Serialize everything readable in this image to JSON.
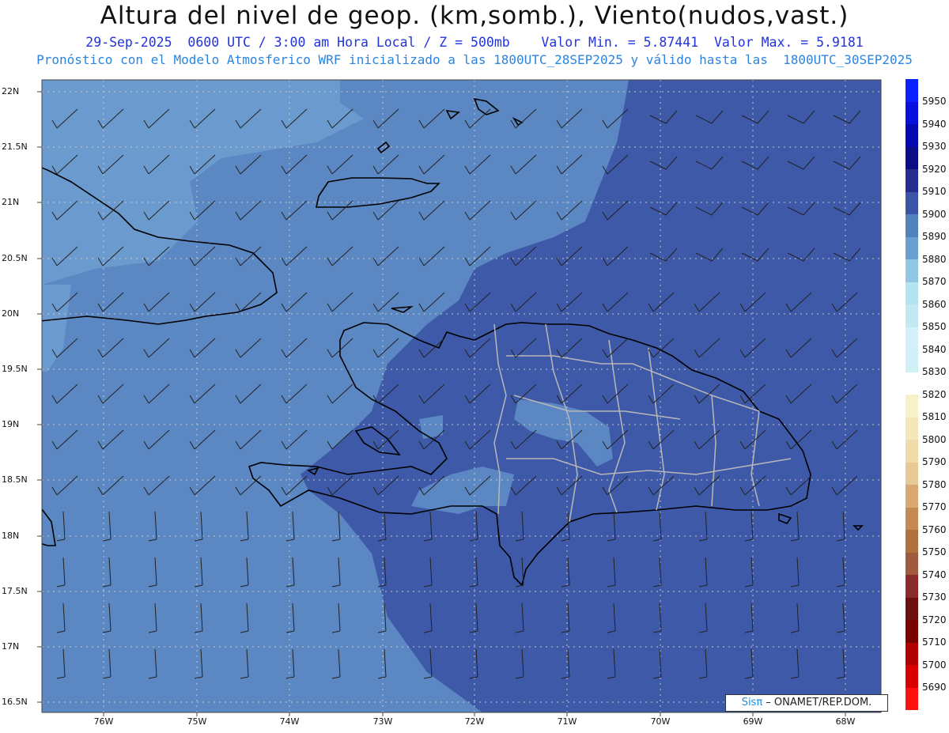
{
  "title": "Altura del nivel de geop. (km,somb.), Viento(nudos,vast.)",
  "subtitle1": "29-Sep-2025  0600 UTC / 3:00 am Hora Local / Z = 500mb    Valor Min. = 5.87441  Valor Max. = 5.9181",
  "subtitle2": "Pronóstico con el Modelo Atmosferico WRF inicializado a las 1800UTC_28SEP2025 y válido hasta las  1800UTC_30SEP2025",
  "lat_labels": [
    "22N",
    "21.5N",
    "21N",
    "20.5N",
    "20N",
    "19.5N",
    "19N",
    "18.5N",
    "18N",
    "17.5N",
    "17N",
    "16.5N"
  ],
  "lon_labels": [
    "76W",
    "75W",
    "74W",
    "73W",
    "72W",
    "71W",
    "70W",
    "69W",
    "68W"
  ],
  "colorbar": {
    "ticks": [
      "5950",
      "5940",
      "5930",
      "5920",
      "5910",
      "5900",
      "5890",
      "5880",
      "5870",
      "5860",
      "5850",
      "5840",
      "5830",
      "5820",
      "5810",
      "5800",
      "5790",
      "5780",
      "5770",
      "5760",
      "5750",
      "5740",
      "5730",
      "5720",
      "5710",
      "5700",
      "5690"
    ],
    "colors": [
      "#0a20ff",
      "#0710dd",
      "#0608b0",
      "#0c0c86",
      "#252e8f",
      "#3b54a6",
      "#5282bd",
      "#6aa0cf",
      "#90c8e3",
      "#b6e3f0",
      "#c4e8f3",
      "#d6f0f7",
      "#cff0f5",
      "#ffffff",
      "#f8f0c8",
      "#f5e8b8",
      "#f0dcaa",
      "#e8ca96",
      "#d8aa72",
      "#c48a52",
      "#b07040",
      "#a05a3e",
      "#8a2a2a",
      "#6a1010",
      "#7a0000",
      "#b00000",
      "#d80000",
      "#ff1010"
    ]
  },
  "credit": {
    "brand": "Sisπ",
    "text": " – ONAMET/REP.DOM."
  }
}
